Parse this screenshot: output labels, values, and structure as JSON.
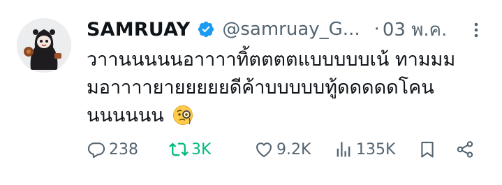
{
  "author": {
    "display_name": "SAMRUAY",
    "handle": "@samruay_G...",
    "separator": "·",
    "date": "03 พ.ค."
  },
  "tweet": {
    "text": "วาานนนนนอาาาาทิ้ตตตตแบบบบบเน้ ทามมม\nมอาาาายายยยยยดีค้าบบบบบทู้ดดดดดโคน\nนนนนนน",
    "emoji": "face-with-monocle-icon"
  },
  "actions": {
    "replies": "238",
    "retweets": "3K",
    "likes": "9.2K",
    "views": "135K"
  },
  "colors": {
    "text_primary": "#0f1419",
    "text_secondary": "#536471",
    "verified_blue": "#1d9bf0",
    "retweet_green": "#00ba7c"
  }
}
